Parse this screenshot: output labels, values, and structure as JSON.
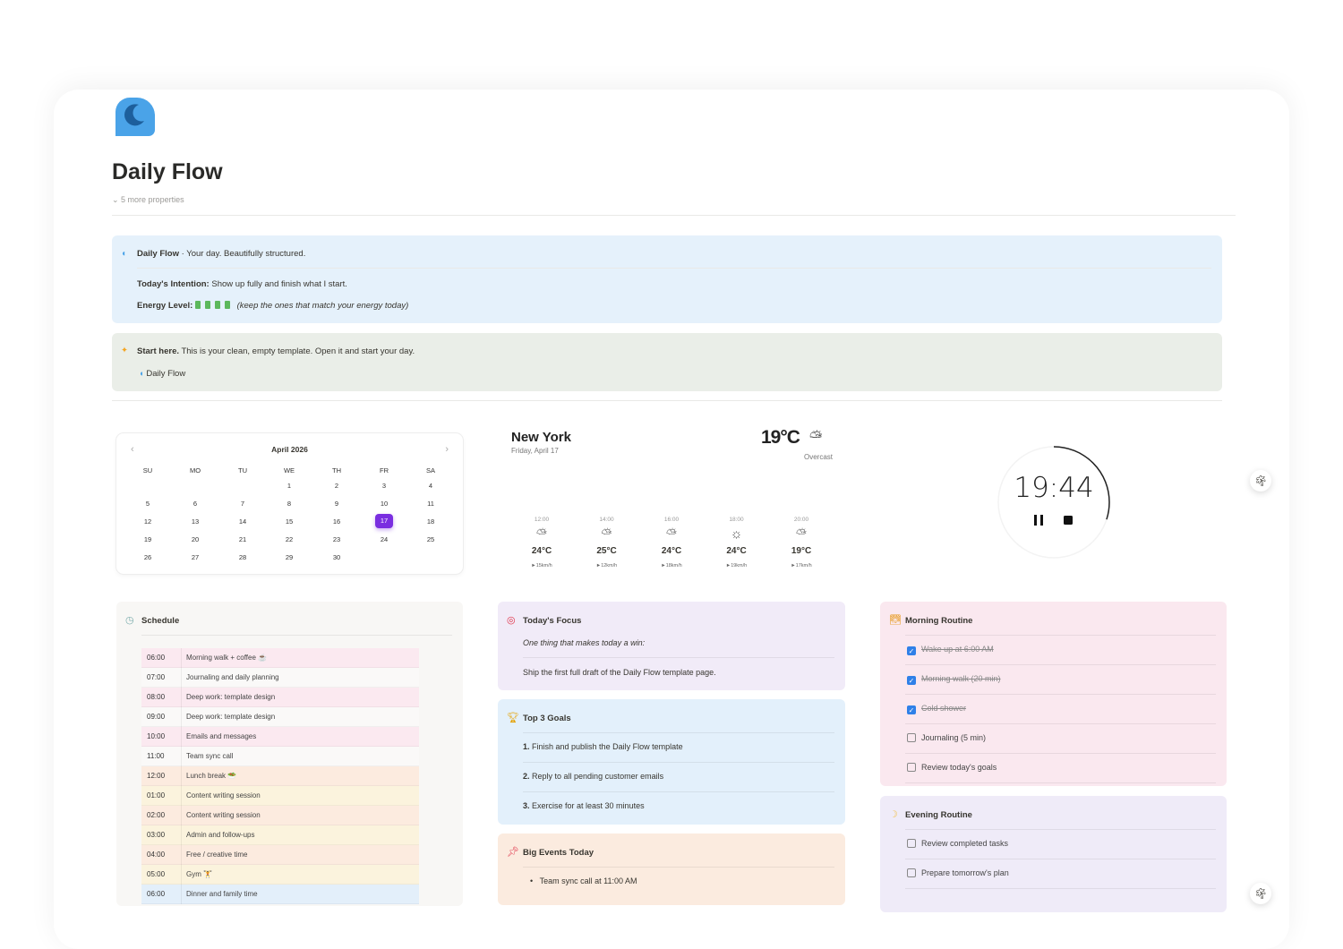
{
  "page": {
    "title": "Daily Flow",
    "more_properties": "5 more properties"
  },
  "callout1": {
    "brand": "Daily Flow",
    "tagline": " · Your day. Beautifully structured.",
    "intention_label": "Today's Intention:",
    "intention": " Show up fully and finish what I start.",
    "energy_label": "Energy Level:",
    "energy_levels": 4,
    "energy_note": "(keep the ones that match your energy today)"
  },
  "callout2": {
    "lead": "Start here.",
    "text": " This is your clean, empty template. Open it and start your day.",
    "link": "Daily Flow"
  },
  "calendar": {
    "month": "April 2026",
    "weekdays": [
      "SU",
      "MO",
      "TU",
      "WE",
      "TH",
      "FR",
      "SA"
    ],
    "selected": 17,
    "first_weekday": 3,
    "days": 30
  },
  "weather": {
    "city": "New York",
    "date": "Friday, April 17",
    "temp": "19°C",
    "condition": "Overcast",
    "hours": [
      {
        "time": "12:00",
        "temp": "24°C",
        "wind": "►15km/h",
        "icon": "partly-cloudy"
      },
      {
        "time": "14:00",
        "temp": "25°C",
        "wind": "►12km/h",
        "icon": "partly-cloudy"
      },
      {
        "time": "16:00",
        "temp": "24°C",
        "wind": "►18km/h",
        "icon": "partly-cloudy"
      },
      {
        "time": "18:00",
        "temp": "24°C",
        "wind": "►19km/h",
        "icon": "sunny"
      },
      {
        "time": "20:00",
        "temp": "19°C",
        "wind": "►17km/h",
        "icon": "partly-cloudy"
      }
    ]
  },
  "timer": {
    "time": "19:44",
    "progress": 0.3
  },
  "schedule": {
    "title": "Schedule",
    "rows": [
      {
        "time": "06:00",
        "event": "Morning walk + coffee ☕",
        "color": "#fbe9f0"
      },
      {
        "time": "07:00",
        "event": "Journaling and daily planning",
        "color": "#faf9f8"
      },
      {
        "time": "08:00",
        "event": "Deep work: template design",
        "color": "#fbe9f0"
      },
      {
        "time": "09:00",
        "event": "Deep work: template design",
        "color": "#faf9f8"
      },
      {
        "time": "10:00",
        "event": "Emails and messages",
        "color": "#fbe9f0"
      },
      {
        "time": "11:00",
        "event": "Team sync call",
        "color": "#faf9f8"
      },
      {
        "time": "12:00",
        "event": "Lunch break 🥗",
        "color": "#fcebdf"
      },
      {
        "time": "01:00",
        "event": "Content writing session",
        "color": "#fbf3dd"
      },
      {
        "time": "02:00",
        "event": "Content writing session",
        "color": "#fcebdf"
      },
      {
        "time": "03:00",
        "event": "Admin and follow-ups",
        "color": "#fbf3dd"
      },
      {
        "time": "04:00",
        "event": "Free / creative time",
        "color": "#fcebdf"
      },
      {
        "time": "05:00",
        "event": "Gym 🏋",
        "color": "#fbf3dd"
      },
      {
        "time": "06:00",
        "event": "Dinner and family time",
        "color": "#e3effa"
      }
    ]
  },
  "focus": {
    "title": "Today's Focus",
    "prompt": "One thing that makes today a win:",
    "text": "Ship the first full draft of the Daily Flow template page."
  },
  "goals": {
    "title": "Top 3 Goals",
    "items": [
      {
        "n": "1.",
        "text": " Finish and publish the Daily Flow template"
      },
      {
        "n": "2.",
        "text": " Reply to all pending customer emails"
      },
      {
        "n": "3.",
        "text": " Exercise for at least 30 minutes"
      }
    ]
  },
  "events": {
    "title": "Big Events Today",
    "items": [
      "Team sync call at 11:00 AM"
    ]
  },
  "morning": {
    "title": "Morning Routine",
    "items": [
      {
        "label": "Wake up at 6:00 AM",
        "done": true
      },
      {
        "label": "Morning walk (20 min)",
        "done": true
      },
      {
        "label": "Cold shower",
        "done": true
      },
      {
        "label": "Journaling (5 min)",
        "done": false
      },
      {
        "label": "Review today's goals",
        "done": false
      }
    ]
  },
  "evening": {
    "title": "Evening Routine",
    "items": [
      {
        "label": "Review completed tasks",
        "done": false
      },
      {
        "label": "Prepare tomorrow's plan",
        "done": false
      }
    ]
  },
  "colors": {
    "accent": "#7a2ee0",
    "check": "#2f80e8",
    "brand": "#4aa3e8"
  }
}
